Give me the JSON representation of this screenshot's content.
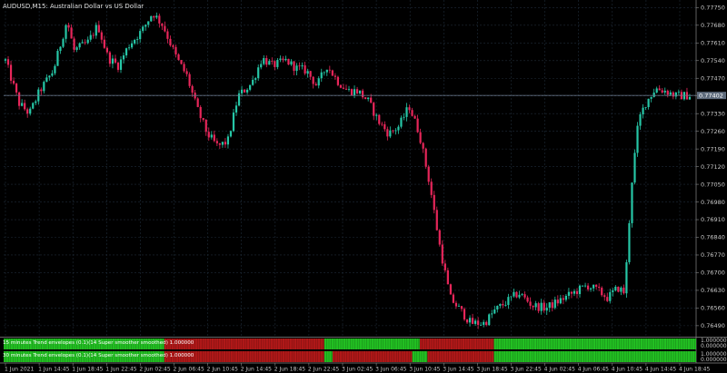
{
  "chart": {
    "title": "AUDUSD,M15:  Australian Dollar vs US Dollar",
    "current_price_label": "0.77402",
    "price_ticks": [
      "0.77750",
      "0.77680",
      "0.77610",
      "0.77540",
      "0.77470",
      "0.77400",
      "0.77330",
      "0.77260",
      "0.77190",
      "0.77120",
      "0.77050",
      "0.76980",
      "0.76910",
      "0.76840",
      "0.76770",
      "0.76700",
      "0.76630",
      "0.76560",
      "0.76490"
    ],
    "time_ticks": [
      "1 Jun 2021",
      "1 Jun 14:45",
      "1 Jun 18:45",
      "1 Jun 22:45",
      "2 Jun 02:45",
      "2 Jun 06:45",
      "2 Jun 10:45",
      "2 Jun 14:45",
      "2 Jun 18:45",
      "2 Jun 22:45",
      "3 Jun 02:45",
      "3 Jun 06:45",
      "3 Jun 10:45",
      "3 Jun 14:45",
      "3 Jun 18:45",
      "3 Jun 22:45",
      "4 Jun 02:45",
      "4 Jun 06:45",
      "4 Jun 10:45",
      "4 Jun 14:45",
      "4 Jun 18:45"
    ]
  },
  "indicator": {
    "row1_label": "15 minutes Trend envelopes (0.1)(14 Super smoother smoothed) 1.000000",
    "row2_label": "30 minutes Trend envelopes (0.1)(14 Super smoother smoothed) 1.000000",
    "row1_segments": [
      {
        "color": "green",
        "from": 0,
        "to": 0.232
      },
      {
        "color": "red",
        "from": 0.232,
        "to": 0.463
      },
      {
        "color": "green",
        "from": 0.463,
        "to": 0.601
      },
      {
        "color": "red",
        "from": 0.601,
        "to": 0.708
      },
      {
        "color": "green",
        "from": 0.708,
        "to": 1
      }
    ],
    "row2_segments": [
      {
        "color": "green",
        "from": 0,
        "to": 0.232
      },
      {
        "color": "red",
        "from": 0.232,
        "to": 0.463
      },
      {
        "color": "green",
        "from": 0.463,
        "to": 0.475
      },
      {
        "color": "red",
        "from": 0.475,
        "to": 0.59
      },
      {
        "color": "green",
        "from": 0.59,
        "to": 0.612
      },
      {
        "color": "red",
        "from": 0.612,
        "to": 0.708
      },
      {
        "color": "green",
        "from": 0.708,
        "to": 1
      }
    ],
    "scale_ticks": [
      "1.000000",
      "0.000000",
      "1.000000",
      "0.000000"
    ]
  },
  "colors": {
    "background": "#000000",
    "grid": "#1f2b38",
    "up_candle": "#26c6a6",
    "down_candle": "#e8265a",
    "axis_text": "#c8c8c8",
    "indicator_green": "#22c022",
    "indicator_red": "#b01818",
    "price_line": "#6c7a8c"
  },
  "chart_data": {
    "type": "candlestick",
    "symbol": "AUDUSD",
    "timeframe": "M15",
    "ylim": [
      0.7645,
      0.7778
    ],
    "current_price": 0.77402,
    "close_path": [
      {
        "t": 0,
        "p": 0.7754
      },
      {
        "t": 0.02,
        "p": 0.7737
      },
      {
        "t": 0.035,
        "p": 0.7733
      },
      {
        "t": 0.05,
        "p": 0.7742
      },
      {
        "t": 0.07,
        "p": 0.775
      },
      {
        "t": 0.09,
        "p": 0.777
      },
      {
        "t": 0.1,
        "p": 0.7758
      },
      {
        "t": 0.12,
        "p": 0.7761
      },
      {
        "t": 0.135,
        "p": 0.7768
      },
      {
        "t": 0.15,
        "p": 0.7755
      },
      {
        "t": 0.165,
        "p": 0.7752
      },
      {
        "t": 0.18,
        "p": 0.776
      },
      {
        "t": 0.2,
        "p": 0.7766
      },
      {
        "t": 0.215,
        "p": 0.7773
      },
      {
        "t": 0.23,
        "p": 0.7768
      },
      {
        "t": 0.25,
        "p": 0.7755
      },
      {
        "t": 0.265,
        "p": 0.7748
      },
      {
        "t": 0.28,
        "p": 0.7735
      },
      {
        "t": 0.295,
        "p": 0.7725
      },
      {
        "t": 0.31,
        "p": 0.772
      },
      {
        "t": 0.325,
        "p": 0.7722
      },
      {
        "t": 0.34,
        "p": 0.774
      },
      {
        "t": 0.36,
        "p": 0.7745
      },
      {
        "t": 0.375,
        "p": 0.7755
      },
      {
        "t": 0.39,
        "p": 0.7752
      },
      {
        "t": 0.41,
        "p": 0.7754
      },
      {
        "t": 0.425,
        "p": 0.7751
      },
      {
        "t": 0.44,
        "p": 0.775
      },
      {
        "t": 0.455,
        "p": 0.7744
      },
      {
        "t": 0.47,
        "p": 0.7752
      },
      {
        "t": 0.485,
        "p": 0.7746
      },
      {
        "t": 0.5,
        "p": 0.7742
      },
      {
        "t": 0.515,
        "p": 0.7742
      },
      {
        "t": 0.53,
        "p": 0.7738
      },
      {
        "t": 0.545,
        "p": 0.773
      },
      {
        "t": 0.56,
        "p": 0.7725
      },
      {
        "t": 0.575,
        "p": 0.7728
      },
      {
        "t": 0.59,
        "p": 0.7736
      },
      {
        "t": 0.605,
        "p": 0.7725
      },
      {
        "t": 0.62,
        "p": 0.7705
      },
      {
        "t": 0.635,
        "p": 0.768
      },
      {
        "t": 0.65,
        "p": 0.766
      },
      {
        "t": 0.665,
        "p": 0.7655
      },
      {
        "t": 0.68,
        "p": 0.765
      },
      {
        "t": 0.7,
        "p": 0.765
      },
      {
        "t": 0.715,
        "p": 0.7655
      },
      {
        "t": 0.73,
        "p": 0.7658
      },
      {
        "t": 0.75,
        "p": 0.7662
      },
      {
        "t": 0.77,
        "p": 0.7657
      },
      {
        "t": 0.79,
        "p": 0.7656
      },
      {
        "t": 0.81,
        "p": 0.7659
      },
      {
        "t": 0.83,
        "p": 0.7662
      },
      {
        "t": 0.85,
        "p": 0.7665
      },
      {
        "t": 0.865,
        "p": 0.7663
      },
      {
        "t": 0.88,
        "p": 0.766
      },
      {
        "t": 0.895,
        "p": 0.7664
      },
      {
        "t": 0.905,
        "p": 0.7662
      },
      {
        "t": 0.915,
        "p": 0.7705
      },
      {
        "t": 0.925,
        "p": 0.773
      },
      {
        "t": 0.935,
        "p": 0.7737
      },
      {
        "t": 0.95,
        "p": 0.7743
      },
      {
        "t": 0.965,
        "p": 0.7742
      },
      {
        "t": 0.98,
        "p": 0.774
      },
      {
        "t": 1,
        "p": 0.77402
      }
    ]
  }
}
